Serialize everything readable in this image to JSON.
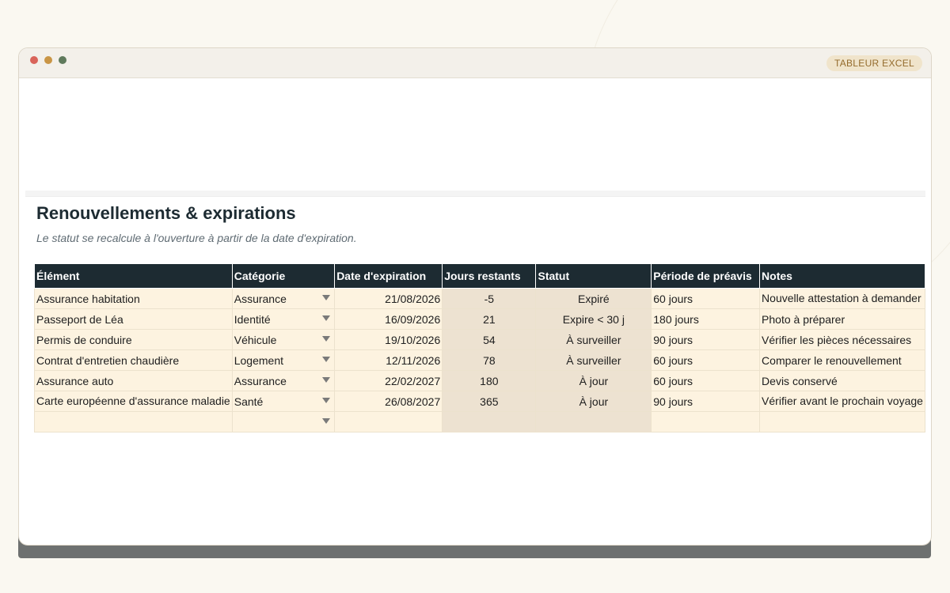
{
  "app": {
    "badge": "TABLEUR EXCEL"
  },
  "sheet": {
    "title": "Renouvellements & expirations",
    "subtitle": "Le statut se recalcule à l'ouverture à partir de la date d'expiration."
  },
  "table": {
    "headers": [
      "Élément",
      "Catégorie",
      "Date d'expiration",
      "Jours restants",
      "Statut",
      "Période de préavis",
      "Notes"
    ],
    "rows": [
      {
        "element": "Assurance habitation",
        "categorie": "Assurance",
        "date": "21/08/2026",
        "jours": "-5",
        "statut": "Expiré",
        "preavis": "60 jours",
        "notes": "Nouvelle attestation à demander"
      },
      {
        "element": "Passeport de Léa",
        "categorie": "Identité",
        "date": "16/09/2026",
        "jours": "21",
        "statut": "Expire < 30 j",
        "preavis": "180 jours",
        "notes": "Photo à préparer"
      },
      {
        "element": "Permis de conduire",
        "categorie": "Véhicule",
        "date": "19/10/2026",
        "jours": "54",
        "statut": "À surveiller",
        "preavis": "90 jours",
        "notes": "Vérifier les pièces nécessaires"
      },
      {
        "element": "Contrat d'entretien chaudière",
        "categorie": "Logement",
        "date": "12/11/2026",
        "jours": "78",
        "statut": "À surveiller",
        "preavis": "60 jours",
        "notes": "Comparer le renouvellement"
      },
      {
        "element": "Assurance auto",
        "categorie": "Assurance",
        "date": "22/02/2027",
        "jours": "180",
        "statut": "À jour",
        "preavis": "60 jours",
        "notes": "Devis conservé"
      },
      {
        "element": "Carte européenne d'assurance maladie",
        "categorie": "Santé",
        "date": "26/08/2027",
        "jours": "365",
        "statut": "À jour",
        "preavis": "90 jours",
        "notes": "Vérifier avant le prochain voyage"
      },
      {
        "element": "",
        "categorie": "",
        "date": "",
        "jours": "",
        "statut": "",
        "preavis": "",
        "notes": ""
      }
    ]
  }
}
